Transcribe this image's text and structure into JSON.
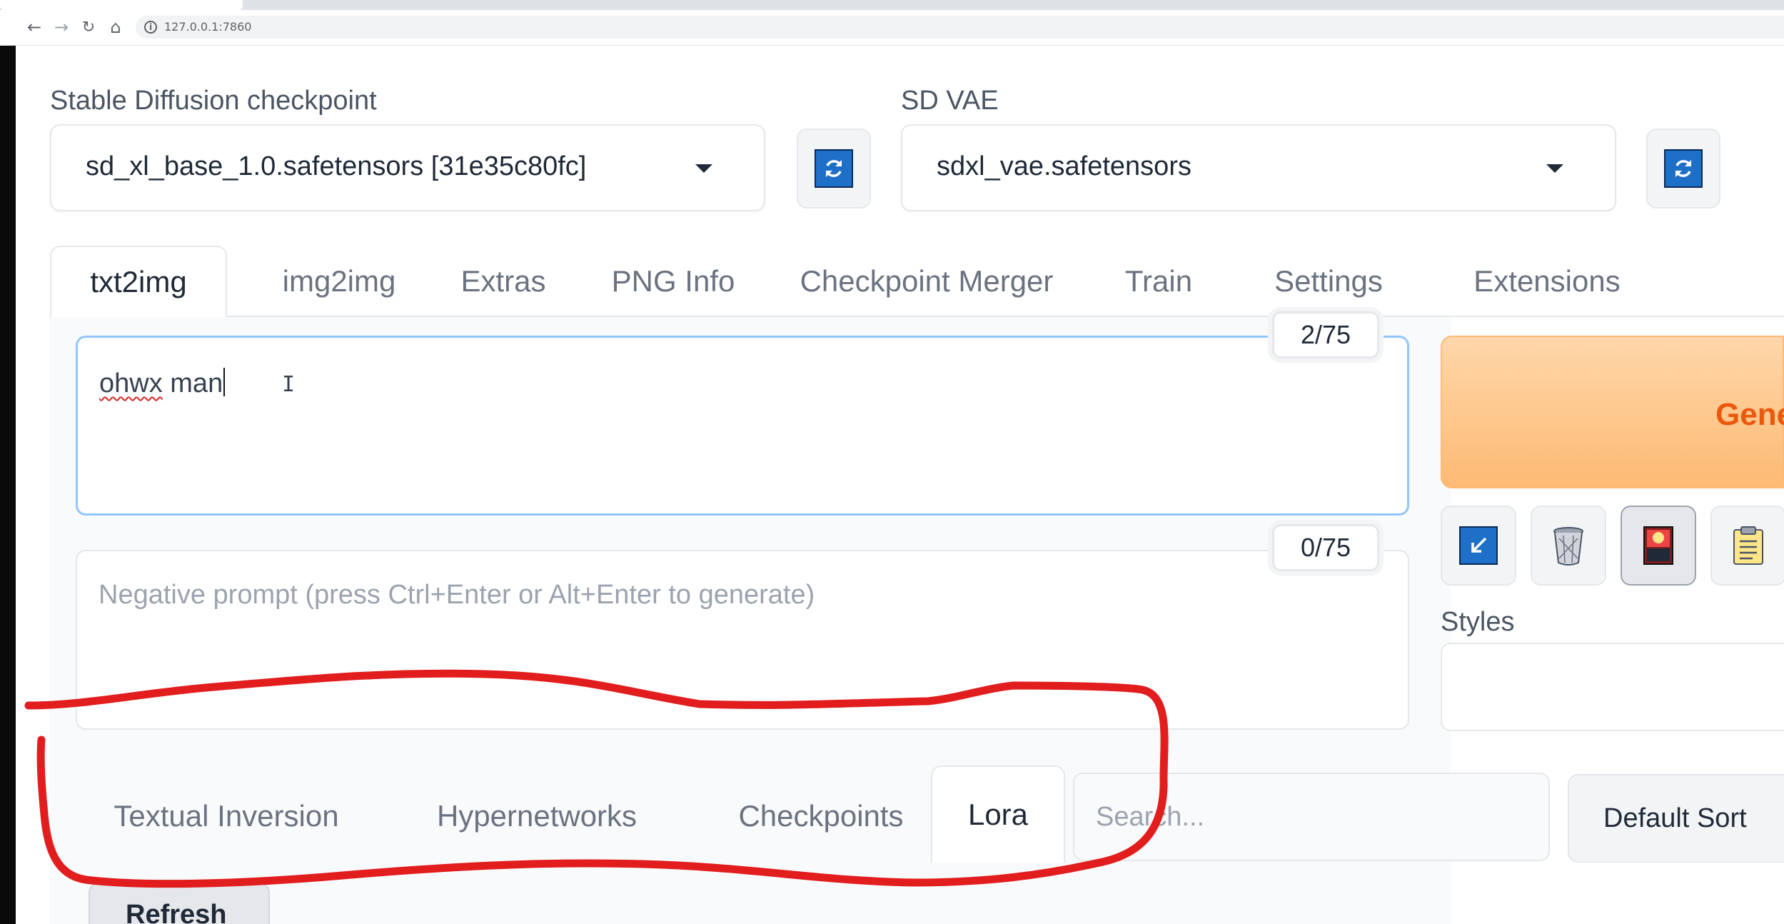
{
  "browser": {
    "url": "127.0.0.1:7860",
    "nav": {
      "back": "←",
      "forward": "→",
      "reload": "↻",
      "home": "⌂",
      "info": "i"
    }
  },
  "checkpoint": {
    "label": "Stable Diffusion checkpoint",
    "value": "sd_xl_base_1.0.safetensors [31e35c80fc]"
  },
  "vae": {
    "label": "SD VAE",
    "value": "sdxl_vae.safetensors"
  },
  "tabs": [
    {
      "label": "txt2img",
      "active": true
    },
    {
      "label": "img2img"
    },
    {
      "label": "Extras"
    },
    {
      "label": "PNG Info"
    },
    {
      "label": "Checkpoint Merger"
    },
    {
      "label": "Train"
    },
    {
      "label": "Settings"
    },
    {
      "label": "Extensions"
    }
  ],
  "prompt": {
    "word1": "ohwx",
    "word2": " man",
    "counter": "2/75"
  },
  "negative_prompt": {
    "placeholder": "Negative prompt (press Ctrl+Enter or Alt+Enter to generate)",
    "counter": "0/75"
  },
  "generate": {
    "label": "Gene"
  },
  "styles": {
    "label": "Styles"
  },
  "tool_icons": [
    "arrow-icon",
    "trash-icon",
    "image-icon",
    "clipboard-icon"
  ],
  "extra_networks": {
    "tabs": [
      {
        "label": "Textual Inversion"
      },
      {
        "label": "Hypernetworks"
      },
      {
        "label": "Checkpoints"
      },
      {
        "label": "Lora",
        "active": true
      }
    ],
    "search_placeholder": "Search...",
    "sort_label": "Default Sort",
    "refresh_label": "Refresh"
  },
  "colors": {
    "accent_blue": "#1e6fc8",
    "generate_orange": "#ea580c",
    "annotation_red": "#e11d1d"
  }
}
